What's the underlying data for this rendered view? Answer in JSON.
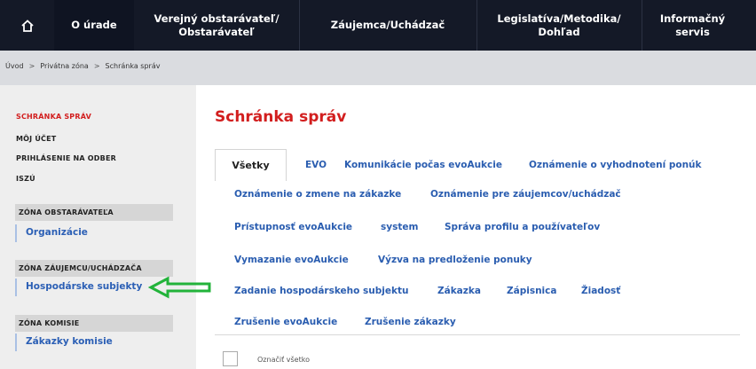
{
  "nav": {
    "home_icon": "home-icon",
    "items": [
      {
        "label": "O úrade"
      },
      {
        "label": "Verejný obstarávateľ/ Obstarávateľ"
      },
      {
        "label": "Záujemca/Uchádzač"
      },
      {
        "label": "Legislatíva/Metodika/ Dohľad"
      },
      {
        "label": "Informačný servis"
      }
    ]
  },
  "breadcrumb": [
    "Úvod",
    "Privátna zóna",
    "Schránka správ"
  ],
  "breadcrumb_sep": ">",
  "sidebar": {
    "links": [
      {
        "label": "SCHRÁNKA SPRÁV",
        "active": true
      },
      {
        "label": "MÔJ ÚČET"
      },
      {
        "label": "PRIHLÁSENIE NA ODBER"
      },
      {
        "label": "ISZÚ"
      }
    ],
    "zones": [
      {
        "header": "ZÓNA OBSTARÁVATEĽA",
        "item": "Organizácie"
      },
      {
        "header": "ZÓNA ZÁUJEMCU/UCHÁDZAČA",
        "item": "Hospodárske subjekty"
      },
      {
        "header": "ZÓNA KOMISIE",
        "item": "Zákazky komisie"
      }
    ]
  },
  "main": {
    "title": "Schránka správ",
    "tabs": [
      [
        "Všetky",
        "EVO",
        "Komunikácie počas evoAukcie",
        "Oznámenie o vyhodnotení ponúk"
      ],
      [
        "Oznámenie o zmene na zákazke",
        "Oznámenie pre záujemcov/uchádzač"
      ],
      [
        "Prístupnosť evoAukcie",
        "system",
        "Správa profilu a používateľov"
      ],
      [
        "Vymazanie evoAukcie",
        "Výzva na predloženie ponuky"
      ],
      [
        "Zadanie hospodárskeho subjektu",
        "Zákazka",
        "Zápisnica",
        "Žiadosť"
      ],
      [
        "Zrušenie evoAukcie",
        "Zrušenie zákazky"
      ]
    ],
    "select_all_label": "Označiť všetko"
  },
  "colors": {
    "nav_bg": "#141927",
    "accent_red": "#d21e1e",
    "link_blue": "#2a5db0",
    "arrow_green": "#22b33a"
  }
}
